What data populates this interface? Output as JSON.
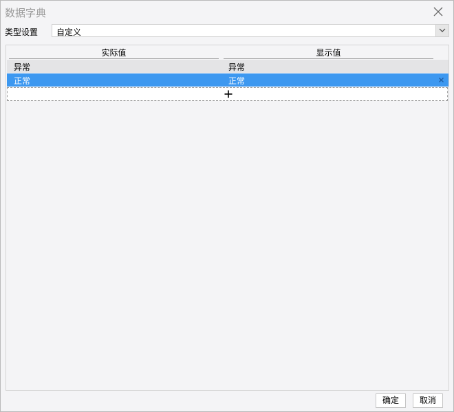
{
  "dialog": {
    "title": "数据字典"
  },
  "type_setting": {
    "label": "类型设置",
    "value": "自定义"
  },
  "table": {
    "columns": [
      "实际值",
      "显示值"
    ],
    "rows": [
      {
        "actual": "异常",
        "display": "异常",
        "selected": false
      },
      {
        "actual": "正常",
        "display": "正常",
        "selected": true
      }
    ]
  },
  "icons": {
    "close": "close-icon",
    "dropdown": "chevron-down-icon",
    "add": "plus-icon",
    "delete": "x-icon"
  },
  "buttons": {
    "ok": "确定",
    "cancel": "取消"
  },
  "colors": {
    "selected_row": "#3d98f0",
    "title_text": "#9a9a9a"
  }
}
